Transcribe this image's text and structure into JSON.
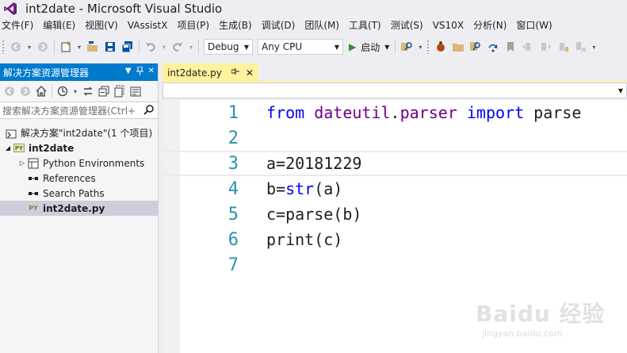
{
  "window": {
    "title": "int2date - Microsoft Visual Studio"
  },
  "menu": {
    "items": [
      "文件(F)",
      "编辑(E)",
      "视图(V)",
      "VAssistX",
      "项目(P)",
      "生成(B)",
      "调试(D)",
      "团队(M)",
      "工具(T)",
      "测试(S)",
      "VS10X",
      "分析(N)",
      "窗口(W)"
    ]
  },
  "toolbar": {
    "configuration": "Debug",
    "platform": "Any CPU",
    "start_label": "启动"
  },
  "solution_explorer": {
    "title": "解决方案资源管理器",
    "search_placeholder": "搜索解决方案资源管理器(Ctrl+",
    "solution_label": "解决方案\"int2date\"(1 个项目)",
    "project_label": "int2date",
    "project_badge": "PY",
    "items": [
      {
        "label": "Python Environments"
      },
      {
        "label": "References"
      },
      {
        "label": "Search Paths"
      },
      {
        "label": "int2date.py",
        "badge": "PY"
      }
    ]
  },
  "editor": {
    "tab_label": "int2date.py",
    "lines": [
      {
        "number": "1",
        "tokens": [
          {
            "t": "from",
            "c": "kw"
          },
          {
            "t": " ",
            "c": ""
          },
          {
            "t": "dateutil",
            "c": "mod"
          },
          {
            "t": ".",
            "c": ""
          },
          {
            "t": "parser",
            "c": "mod"
          },
          {
            "t": " ",
            "c": ""
          },
          {
            "t": "import",
            "c": "kw"
          },
          {
            "t": " parse",
            "c": ""
          }
        ]
      },
      {
        "number": "2",
        "tokens": []
      },
      {
        "number": "3",
        "tokens": [
          {
            "t": "a=20181229",
            "c": ""
          }
        ]
      },
      {
        "number": "4",
        "tokens": [
          {
            "t": "b=",
            "c": ""
          },
          {
            "t": "str",
            "c": "bi"
          },
          {
            "t": "(a)",
            "c": ""
          }
        ]
      },
      {
        "number": "5",
        "tokens": [
          {
            "t": "c=parse(b)",
            "c": ""
          }
        ]
      },
      {
        "number": "6",
        "tokens": [
          {
            "t": "print(c)",
            "c": ""
          }
        ]
      },
      {
        "number": "7",
        "tokens": []
      }
    ]
  },
  "watermark": {
    "logo": "Baidu 经验",
    "url": "jingyan.baidu.com"
  }
}
